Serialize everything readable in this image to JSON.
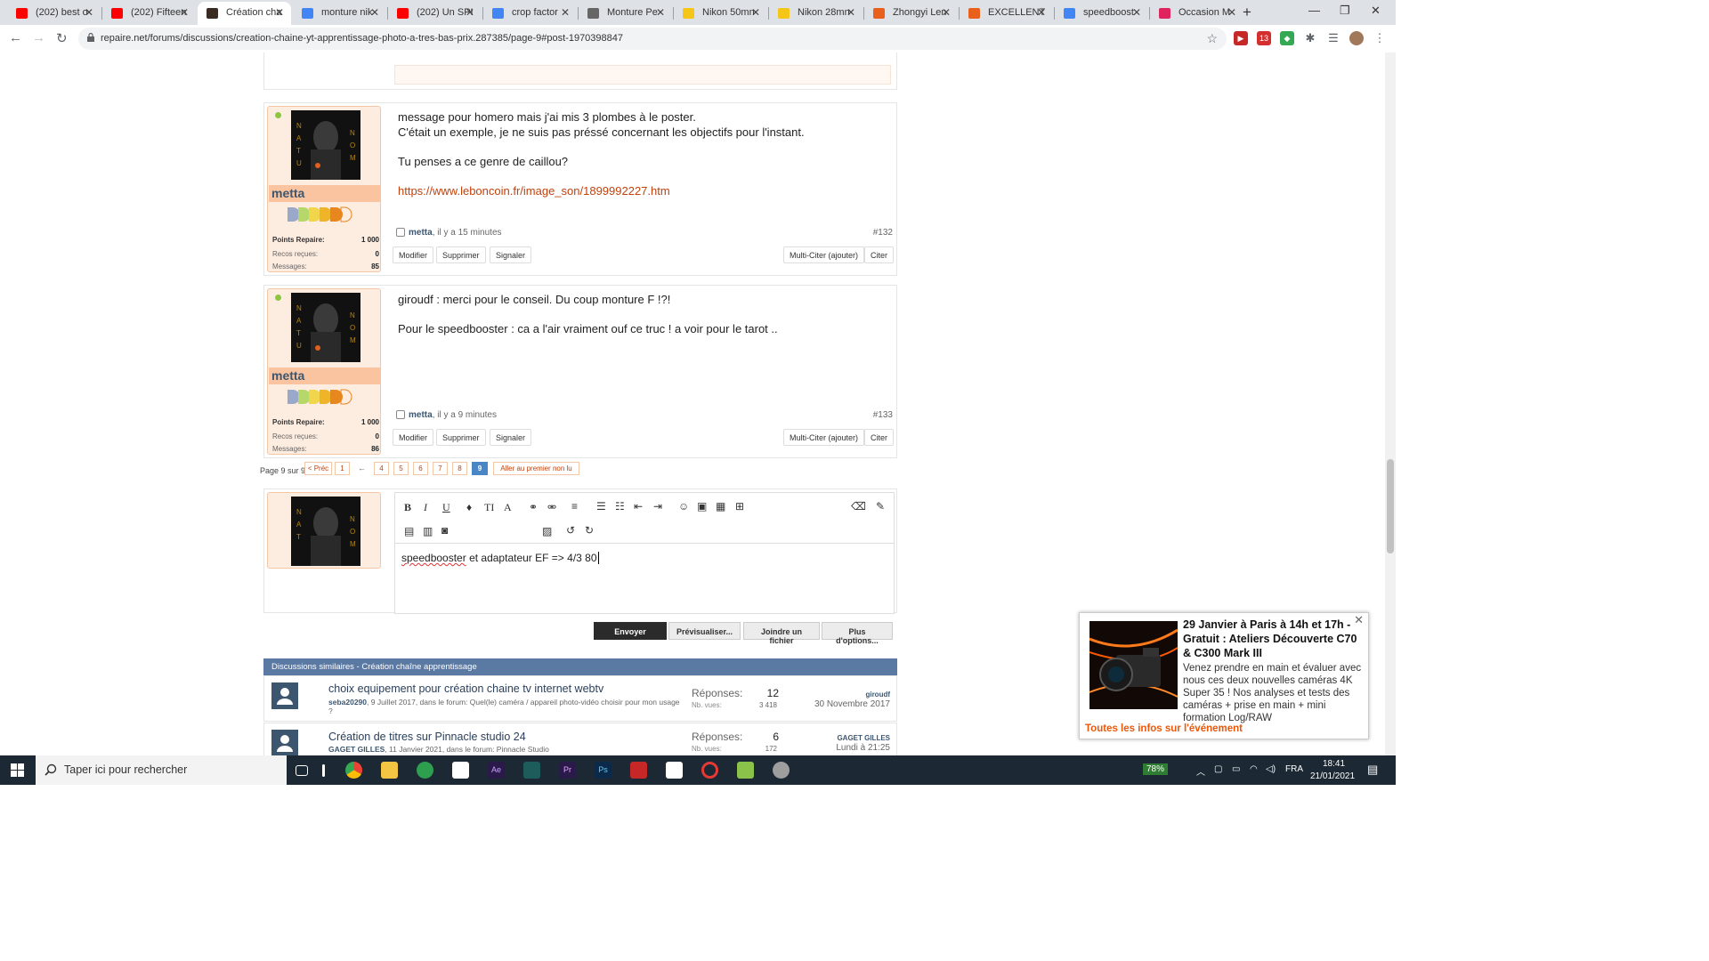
{
  "browser": {
    "tabs": [
      {
        "title": "(202) best o",
        "fav": "#ff0000"
      },
      {
        "title": "(202) Fifteen",
        "fav": "#ff0000"
      },
      {
        "title": "Création cha",
        "fav": "#3a2b22"
      },
      {
        "title": "monture nik",
        "fav": "#4285f4"
      },
      {
        "title": "(202) Un SPI",
        "fav": "#ff0000"
      },
      {
        "title": "crop factor",
        "fav": "#4285f4"
      },
      {
        "title": "Monture Pe",
        "fav": "#666666"
      },
      {
        "title": "Nikon 50mn",
        "fav": "#f5c518"
      },
      {
        "title": "Nikon 28mn",
        "fav": "#f5c518"
      },
      {
        "title": "Zhongyi Len",
        "fav": "#e8601c"
      },
      {
        "title": "EXCELLENT",
        "fav": "#e8601c"
      },
      {
        "title": "speedboost",
        "fav": "#4285f4"
      },
      {
        "title": "Occasion M",
        "fav": "#e0245e"
      }
    ],
    "url": "repaire.net/forums/discussions/creation-chaine-yt-apprentissage-photo-a-tres-bas-prix.287385/page-9#post-1970398847",
    "ext_badge": "13"
  },
  "posts": [
    {
      "username": "metta",
      "points_label": "Points Repaire:",
      "points": "1 000",
      "recos_label": "Recos reçues:",
      "recos": "0",
      "messages_label": "Messages:",
      "messages": "85",
      "lines": [
        "message pour homero mais j'ai mis 3 plombes à le poster.",
        "C'était un exemple, je ne suis pas préssé concernant les objectifs pour l'instant.",
        "",
        "Tu penses a ce genre de caillou?",
        ""
      ],
      "link": "https://www.leboncoin.fr/image_son/1899992227.htm",
      "author": "metta",
      "time": ", il y a 15 minutes",
      "number": "#132"
    },
    {
      "username": "metta",
      "points_label": "Points Repaire:",
      "points": "1 000",
      "recos_label": "Recos reçues:",
      "recos": "0",
      "messages_label": "Messages:",
      "messages": "86",
      "lines": [
        "giroudf : merci pour le conseil. Du coup monture F !?!",
        "",
        "Pour le speedbooster : ca a l'air vraiment ouf ce truc ! a voir pour le tarot .."
      ],
      "author": "metta",
      "time": ", il y a 9 minutes",
      "number": "#133"
    }
  ],
  "post_buttons": {
    "edit": "Modifier",
    "delete": "Supprimer",
    "report": "Signaler",
    "multiquote": "Multi-Citer (ajouter)",
    "quote": "Citer"
  },
  "pager": {
    "label": "Page 9 sur 9",
    "prev": "< Préc",
    "pages": [
      "1",
      "4",
      "5",
      "6",
      "7",
      "8",
      "9"
    ],
    "ellipsis": "←",
    "unread": "Aller au premier non lu"
  },
  "editor": {
    "text_misspelled": "speedbooster",
    "text_rest": " et adaptateur EF => 4/3 80",
    "send": "Envoyer",
    "preview": "Prévisualiser...",
    "attach": "Joindre un fichier",
    "more": "Plus d'options..."
  },
  "similar": {
    "header": "Discussions similaires - Création chaîne apprentissage",
    "replies_label": "Réponses:",
    "views_label": "Nb. vues:",
    "rows": [
      {
        "title": "choix equipement pour création chaine tv internet webtv",
        "author": "seba20290",
        "meta": ", 9 Juillet 2017, dans le forum: Quel(le) caméra / appareil photo-vidéo choisir pour mon usage ?",
        "replies": "12",
        "views": "3 418",
        "last_user": "giroudf",
        "last_date": "30 Novembre 2017"
      },
      {
        "title": "Création de titres sur Pinnacle studio 24",
        "author": "GAGET GILLES",
        "meta": ", 11 Janvier 2021, dans le forum: Pinnacle Studio",
        "replies": "6",
        "views": "172",
        "last_user": "GAGET GILLES",
        "last_date": "Lundi à 21:25"
      }
    ]
  },
  "popup": {
    "title": "29 Janvier à Paris à 14h et 17h - Gratuit : Ateliers Découverte C70 & C300 Mark III",
    "body": "Venez prendre en main et évaluer avec nous ces deux nouvelles caméras 4K Super 35 ! Nos analyses et tests des caméras + prise en main + mini formation Log/RAW",
    "link": "Toutes les infos sur l'événement"
  },
  "taskbar": {
    "search_placeholder": "Taper ici pour rechercher",
    "battery": "78%",
    "lang": "FRA",
    "time": "18:41",
    "date": "21/01/2021"
  }
}
